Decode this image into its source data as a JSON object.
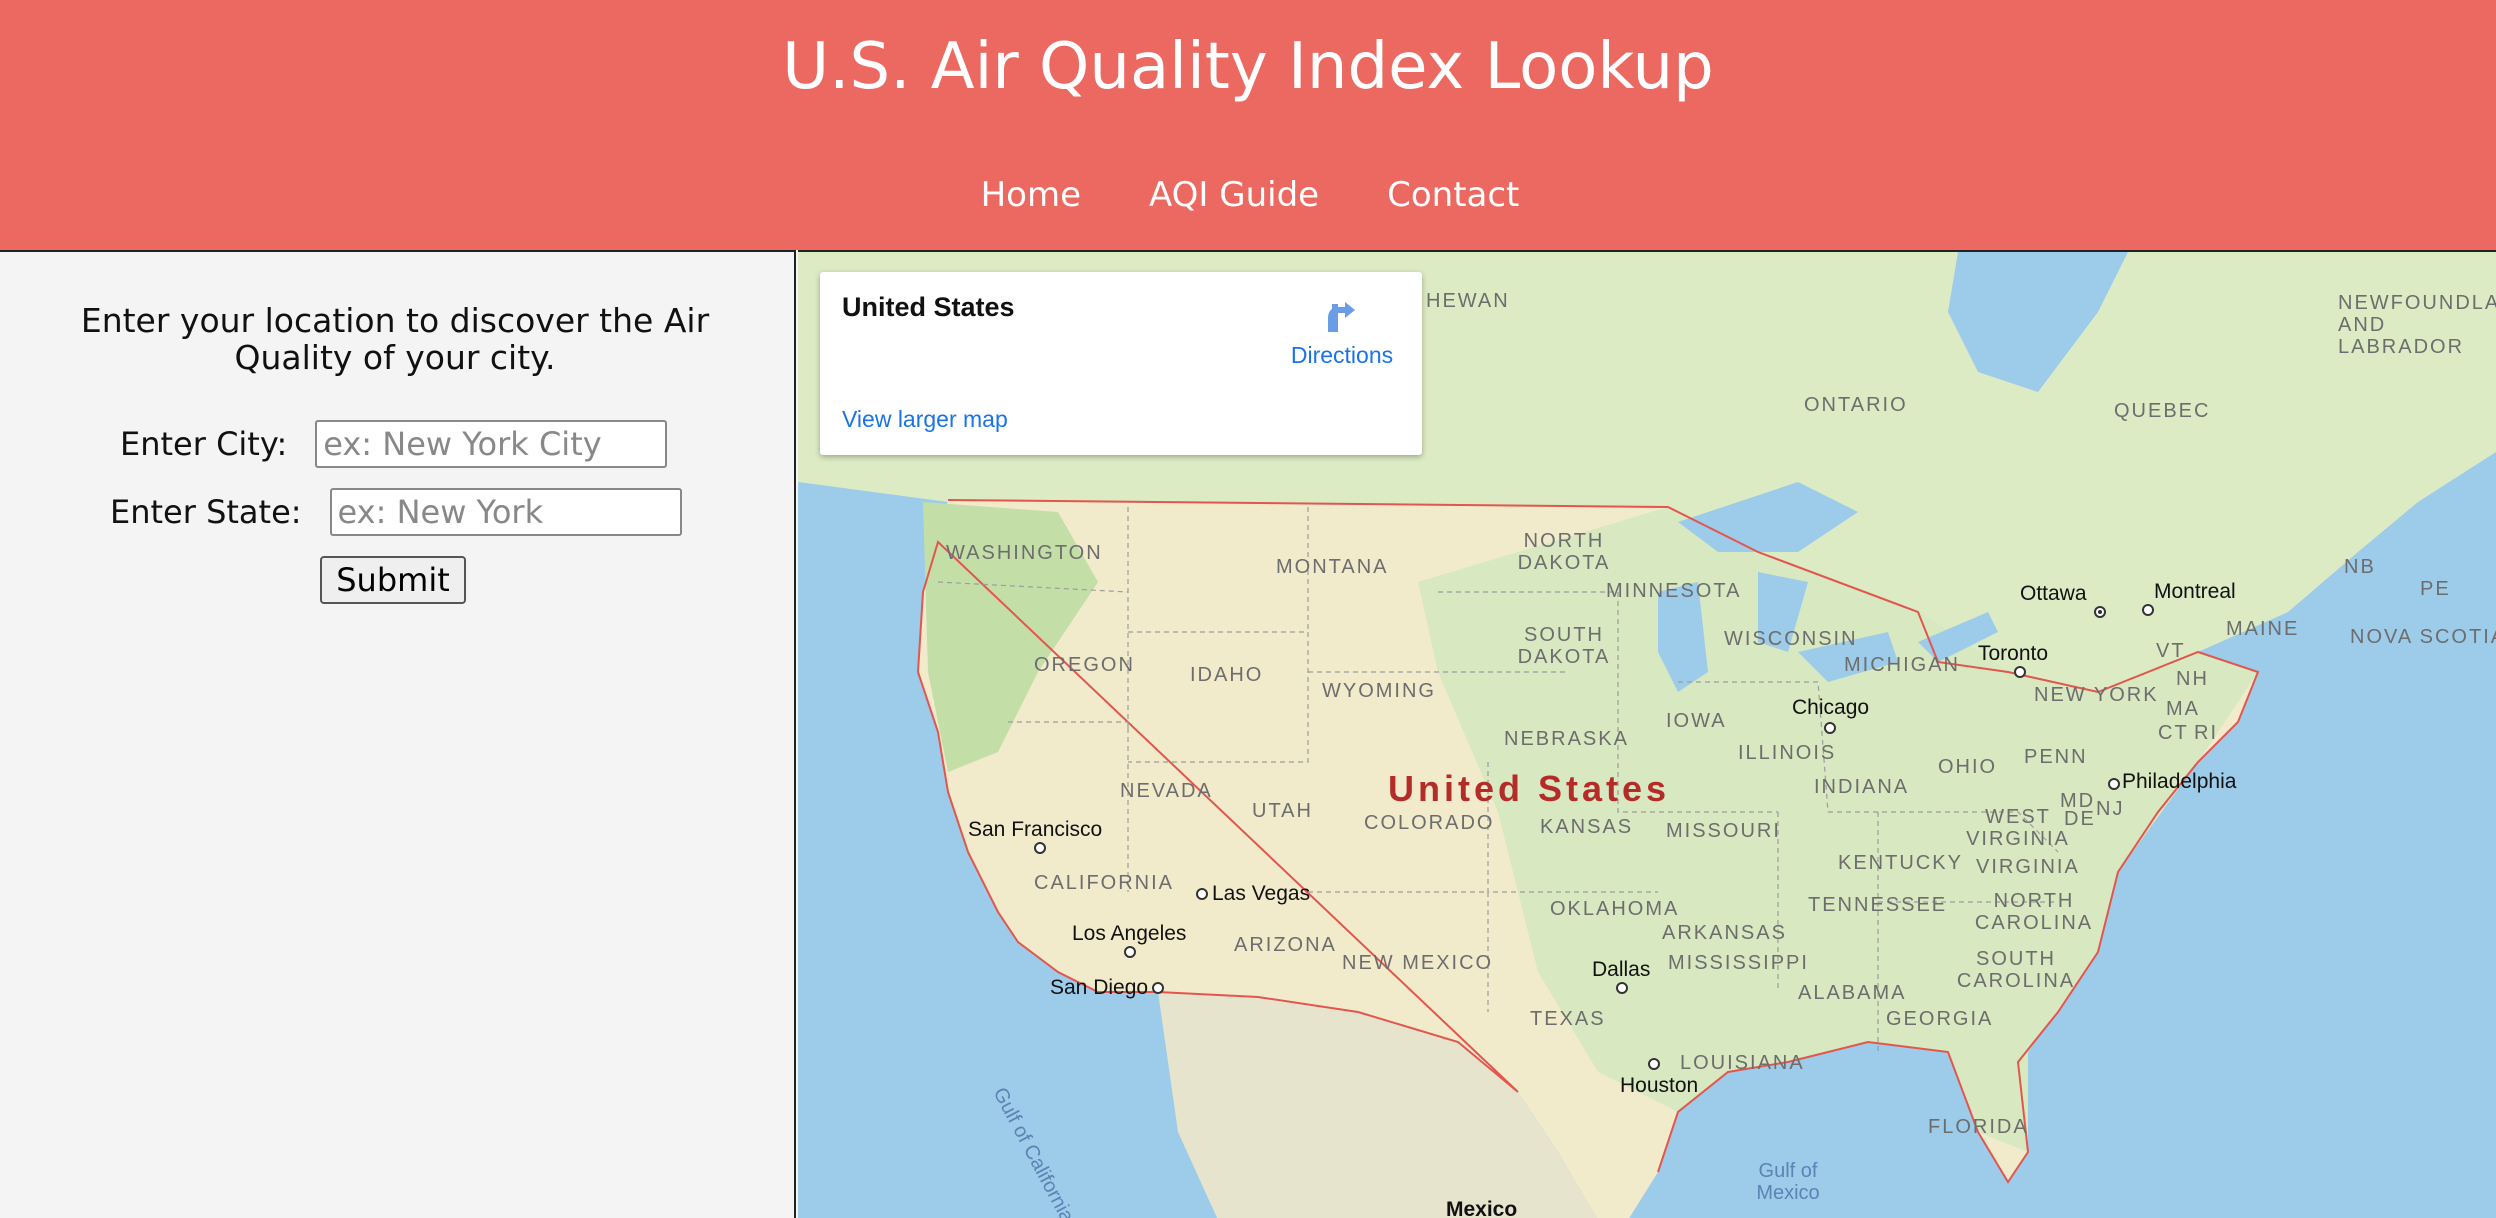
{
  "header": {
    "title": "U.S. Air Quality Index Lookup",
    "nav": [
      "Home",
      "AQI Guide",
      "Contact"
    ]
  },
  "sidebar": {
    "intro": "Enter your location to discover the Air Quality of your city.",
    "city_label": "Enter City:",
    "city_placeholder": "ex: New York City",
    "state_label": "Enter State:",
    "state_placeholder": "ex: New York",
    "submit_label": "Submit"
  },
  "map": {
    "card": {
      "title": "United States",
      "directions_label": "Directions",
      "larger_map_label": "View larger map"
    },
    "country_label": "United States",
    "region_labels": [
      "WASHINGTON",
      "MONTANA",
      "NORTH DAKOTA",
      "MINNESOTA",
      "OREGON",
      "IDAHO",
      "SOUTH DAKOTA",
      "WYOMING",
      "WISCONSIN",
      "MICHIGAN",
      "NEBRASKA",
      "IOWA",
      "ILLINOIS",
      "NEVADA",
      "UTAH",
      "COLORADO",
      "KANSAS",
      "MISSOURI",
      "INDIANA",
      "OHIO",
      "PENN",
      "CALIFORNIA",
      "OKLAHOMA",
      "ARKANSAS",
      "KENTUCKY",
      "WEST VIRGINIA",
      "VIRGINIA",
      "TENNESSEE",
      "NORTH CAROLINA",
      "SOUTH CAROLINA",
      "ARIZONA",
      "NEW MEXICO",
      "MISSISSIPPI",
      "ALABAMA",
      "GEORGIA",
      "TEXAS",
      "LOUISIANA",
      "FLORIDA",
      "NEW YORK",
      "VT",
      "NH",
      "MA",
      "CT",
      "RI",
      "MD",
      "DE",
      "NJ",
      "MAINE",
      "ONTARIO",
      "QUEBEC",
      "NB",
      "PE",
      "NOVA SCOTIA",
      "NEWFOUNDLAND AND LABRADOR",
      "HEWAN"
    ],
    "cities": [
      "Ottawa",
      "Montreal",
      "Toronto",
      "Chicago",
      "Philadelphia",
      "San Francisco",
      "Las Vegas",
      "Los Angeles",
      "San Diego",
      "Dallas",
      "Houston",
      "Mexico"
    ],
    "water_labels": [
      "Gulf of Mexico",
      "Gulf of California"
    ],
    "colors": {
      "land": "#dcebc4",
      "us_land": "#f1ebcc",
      "water": "#9dcbea",
      "border": "#e2564e",
      "forest": "#bfdba6"
    }
  }
}
